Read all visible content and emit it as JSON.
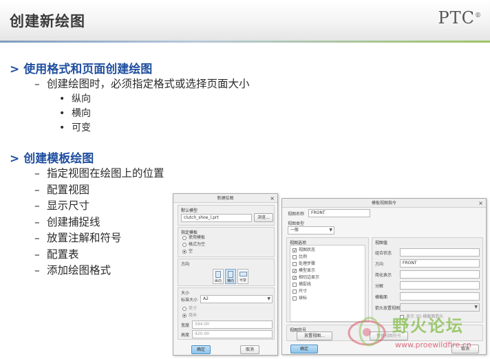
{
  "slide": {
    "title": "创建新绘图",
    "logo": "PTC",
    "logo_mark": "®"
  },
  "section1": {
    "heading": "使用格式和页面创建绘图",
    "item": "创建绘图时，必须指定格式或选择页面大小",
    "subitems": [
      "纵向",
      "横向",
      "可变"
    ]
  },
  "section2": {
    "heading": "创建模板绘图",
    "items": [
      "指定视图在绘图上的位置",
      "配置视图",
      "显示尺寸",
      "创建捕捉线",
      "放置注解和符号",
      "配置表",
      "添加绘图格式"
    ]
  },
  "symbols": {
    "gt": ">",
    "dash": "–",
    "dot": "•"
  },
  "dlg_new": {
    "title": "新建绘图",
    "close": "×",
    "default_model_label": "默认模型",
    "default_model_value": "clutch_shoe_l.prt",
    "browse": "浏览...",
    "template_label": "指定模板",
    "template_options": [
      "使用模板",
      "格式为空",
      "空"
    ],
    "template_selected": 2,
    "orientation_label": "方向",
    "orientations": [
      "纵向",
      "横向",
      "可变"
    ],
    "orientation_selected": 1,
    "size_label": "大小",
    "std_size_label": "标准大小",
    "std_size_value": "A2",
    "units": [
      "英寸",
      "毫米"
    ],
    "units_selected": 1,
    "width_label": "宽度",
    "width_value": "594.00",
    "height_label": "高度",
    "height_value": "420.00",
    "ok": "确定",
    "cancel": "取消"
  },
  "dlg_tpl": {
    "title": "模板视图指令",
    "close": "×",
    "view_name_label": "视图名称",
    "view_name_value": "FRONT",
    "view_type_label": "视图类型",
    "view_type_value": "一般",
    "options_label": "视图选项",
    "options": [
      {
        "label": "视图状态",
        "checked": true
      },
      {
        "label": "比例",
        "checked": false
      },
      {
        "label": "处理步骤",
        "checked": false
      },
      {
        "label": "模型显示",
        "checked": true
      },
      {
        "label": "相切边显示",
        "checked": true
      },
      {
        "label": "捕捉线",
        "checked": false
      },
      {
        "label": "尺寸",
        "checked": false
      },
      {
        "label": "球标",
        "checked": false
      }
    ],
    "values_label": "视图值",
    "values": [
      {
        "label": "组合状态",
        "value": ""
      },
      {
        "label": "方向",
        "value": "FRONT"
      },
      {
        "label": "简化表示",
        "value": ""
      },
      {
        "label": "分解",
        "value": ""
      },
      {
        "label": "横截面",
        "value": ""
      },
      {
        "label": "箭头放置视图",
        "value": ""
      }
    ],
    "show_hint": "显示 3D 横截面箭头",
    "symbol_label": "视图符号",
    "place_view": "放置视图...",
    "replace_symbol": "替换视图符号",
    "ok": "确定",
    "cancel": "取消"
  },
  "watermark": {
    "text": "野火论坛",
    "url": "www.proewildfire.cn"
  },
  "colors": {
    "heading": "#1f4fa0",
    "accent_green": "#9fc464",
    "primary_button": "#8ec4ea"
  }
}
